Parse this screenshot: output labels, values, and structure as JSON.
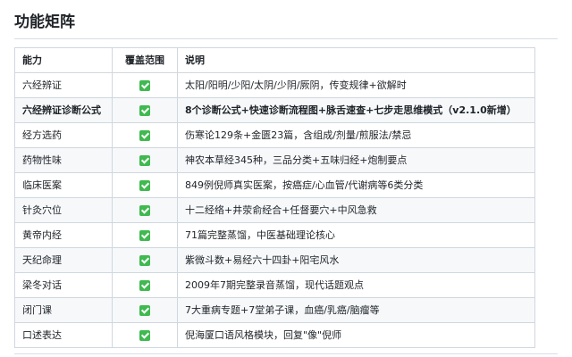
{
  "heading": "功能矩阵",
  "colors": {
    "check": "#3fb950",
    "border": "#d0d7de",
    "stripe": "#f6f8fa"
  },
  "table": {
    "headers": [
      "能力",
      "覆盖范围",
      "说明"
    ],
    "rows": [
      {
        "capability": "六经辨证",
        "covered": true,
        "icon": "check-box-icon",
        "description": "太阳/阳明/少阳/太阴/少阴/厥阴，传变规律+欲解时",
        "bold": false
      },
      {
        "capability": "六经辨证诊断公式",
        "covered": true,
        "icon": "check-box-icon",
        "description": "8个诊断公式+快速诊断流程图+脉舌速查+七步走思维模式（v2.1.0新增）",
        "bold": true
      },
      {
        "capability": "经方选药",
        "covered": true,
        "icon": "check-box-icon",
        "description": "伤寒论129条+金匮23篇，含组成/剂量/煎服法/禁忌",
        "bold": false
      },
      {
        "capability": "药物性味",
        "covered": true,
        "icon": "check-box-icon",
        "description": "神农本草经345种，三品分类+五味归经+炮制要点",
        "bold": false
      },
      {
        "capability": "临床医案",
        "covered": true,
        "icon": "check-box-icon",
        "description": "849例倪师真实医案，按癌症/心血管/代谢病等6类分类",
        "bold": false
      },
      {
        "capability": "针灸穴位",
        "covered": true,
        "icon": "check-box-icon",
        "description": "十二经络+井荥俞经合+任督要穴+中风急救",
        "bold": false
      },
      {
        "capability": "黄帝内经",
        "covered": true,
        "icon": "check-box-icon",
        "description": "71篇完整蒸馏，中医基础理论核心",
        "bold": false
      },
      {
        "capability": "天纪命理",
        "covered": true,
        "icon": "check-box-icon",
        "description": "紫微斗数+易经六十四卦+阳宅风水",
        "bold": false
      },
      {
        "capability": "梁冬对话",
        "covered": true,
        "icon": "check-box-icon",
        "description": "2009年7期完整录音蒸馏，现代话题观点",
        "bold": false
      },
      {
        "capability": "闭门课",
        "covered": true,
        "icon": "check-box-icon",
        "description": "7大重病专题+7堂弟子课，血癌/乳癌/脑瘤等",
        "bold": false
      },
      {
        "capability": "口述表达",
        "covered": true,
        "icon": "check-box-icon",
        "description": "倪海厦口语风格模块，回复\"像\"倪师",
        "bold": false
      }
    ]
  }
}
